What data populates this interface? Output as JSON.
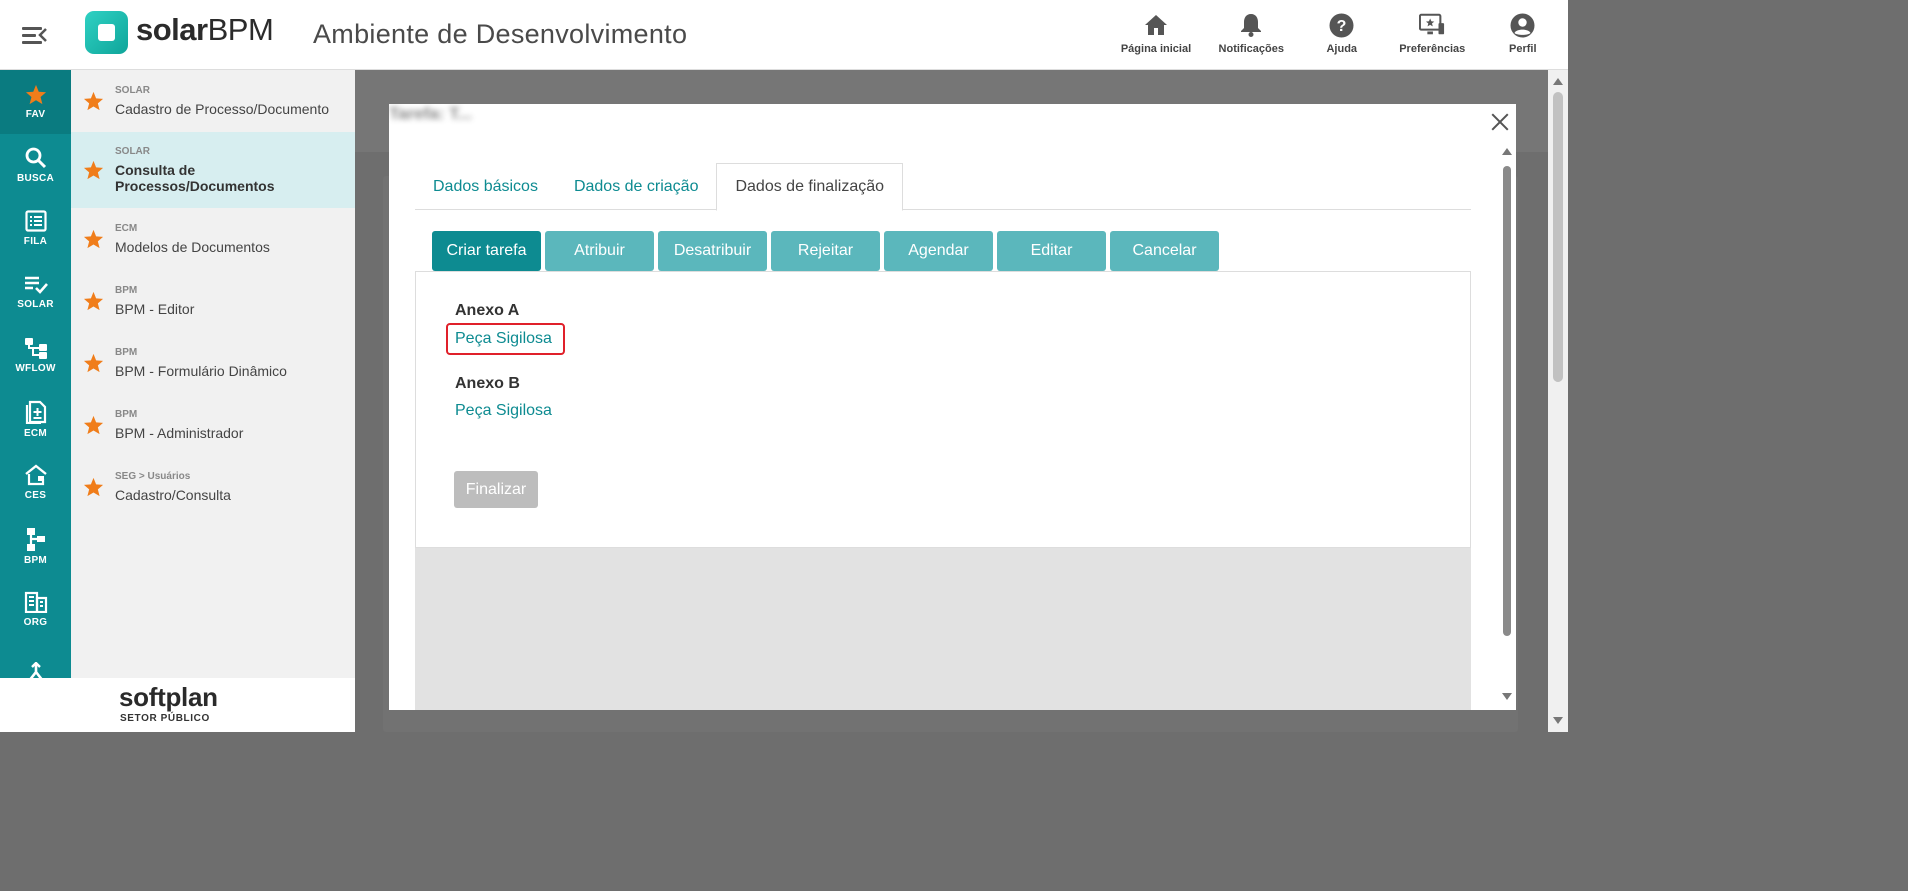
{
  "header": {
    "logo_bold": "solar",
    "logo_light": "BPM",
    "environment_title": "Ambiente de Desenvolvimento",
    "nav": [
      {
        "label": "Página inicial",
        "icon": "home-icon"
      },
      {
        "label": "Notificações",
        "icon": "bell-icon"
      },
      {
        "label": "Ajuda",
        "icon": "help-icon"
      },
      {
        "label": "Preferências",
        "icon": "preferences-icon"
      },
      {
        "label": "Perfil",
        "icon": "profile-icon"
      }
    ]
  },
  "rail": {
    "items": [
      {
        "label": "FAV",
        "icon": "star-icon",
        "active": true
      },
      {
        "label": "BUSCA",
        "icon": "search-icon"
      },
      {
        "label": "FILA",
        "icon": "queue-icon"
      },
      {
        "label": "SOLAR",
        "icon": "solar-icon"
      },
      {
        "label": "WFLOW",
        "icon": "workflow-icon"
      },
      {
        "label": "ECM",
        "icon": "ecm-icon"
      },
      {
        "label": "CES",
        "icon": "ces-icon"
      },
      {
        "label": "BPM",
        "icon": "bpm-icon"
      },
      {
        "label": "ORG",
        "icon": "org-icon"
      },
      {
        "label": "",
        "icon": "merge-icon"
      }
    ]
  },
  "favorites": [
    {
      "category": "SOLAR",
      "name": "Cadastro de Processo/Documento"
    },
    {
      "category": "SOLAR",
      "name": "Consulta de Processos/Documentos",
      "selected": true
    },
    {
      "category": "ECM",
      "name": "Modelos de Documentos"
    },
    {
      "category": "BPM",
      "name": "BPM - Editor"
    },
    {
      "category": "BPM",
      "name": "BPM - Formulário Dinâmico"
    },
    {
      "category": "BPM",
      "name": "BPM - Administrador"
    },
    {
      "category": "SEG > Usuários",
      "name": "Cadastro/Consulta"
    }
  ],
  "footer": {
    "brand": "softplan",
    "subtitle": "SETOR PÚBLICO"
  },
  "modal": {
    "blurred_title": "Tarefa: T...",
    "tabs": [
      {
        "label": "Dados básicos"
      },
      {
        "label": "Dados de criação"
      },
      {
        "label": "Dados de finalização",
        "active": true
      }
    ],
    "actions": [
      {
        "label": "Criar tarefa",
        "primary": true
      },
      {
        "label": "Atribuir"
      },
      {
        "label": "Desatribuir"
      },
      {
        "label": "Rejeitar"
      },
      {
        "label": "Agendar"
      },
      {
        "label": "Editar"
      },
      {
        "label": "Cancelar"
      }
    ],
    "anexos": [
      {
        "title": "Anexo A",
        "link": "Peça Sigilosa",
        "highlighted": true
      },
      {
        "title": "Anexo B",
        "link": "Peça Sigilosa"
      }
    ],
    "finalizar_label": "Finalizar"
  },
  "colors": {
    "teal_primary": "#0d8b91",
    "teal_light": "#5bb7bc",
    "star_orange": "#f07d1a",
    "highlight_red": "#e0202a",
    "disabled_gray": "#bdbdbd"
  }
}
